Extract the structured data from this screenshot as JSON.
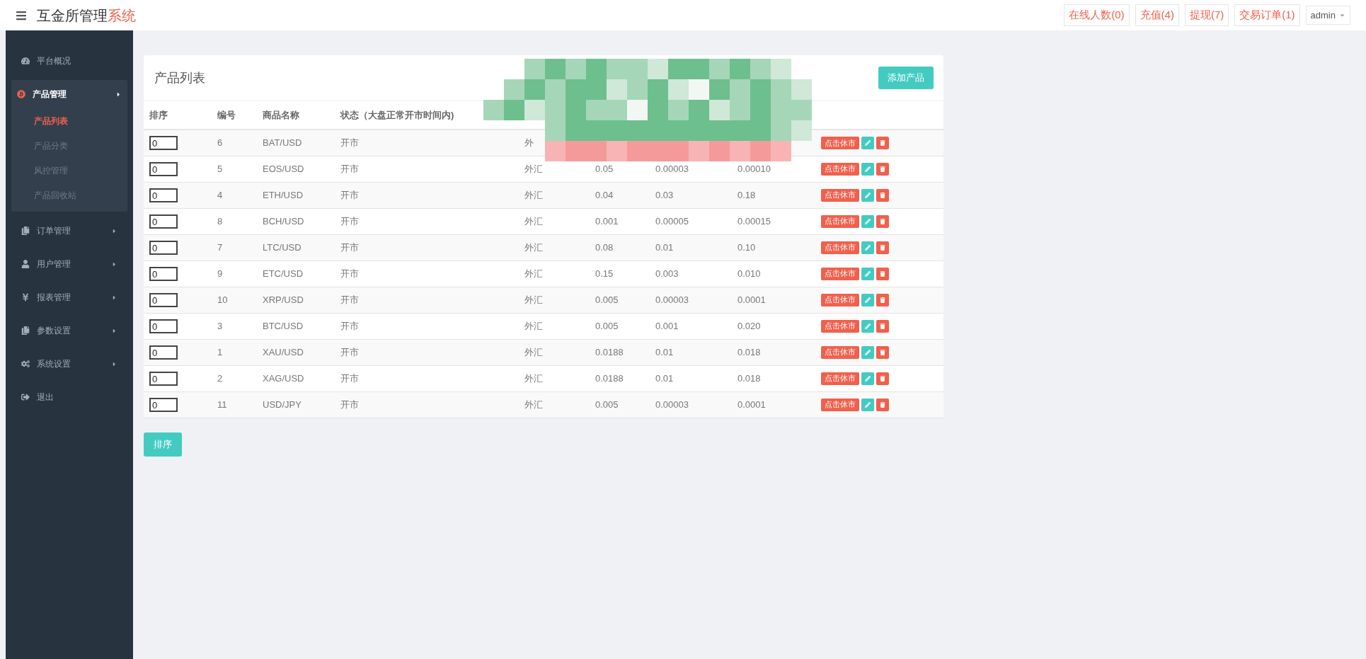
{
  "header": {
    "title": "互金所管理",
    "title_accent": "系统",
    "links": [
      "在线人数(0)",
      "充值(4)",
      "提现(7)",
      "交易订单(1)"
    ],
    "user": "admin"
  },
  "sidebar": {
    "items": [
      {
        "label": "平台概况",
        "expanded": false,
        "has_arrow": false
      },
      {
        "label": "产品管理",
        "expanded": true,
        "has_arrow": true,
        "children": [
          {
            "label": "产品列表",
            "selected": true
          },
          {
            "label": "产品分类",
            "selected": false
          },
          {
            "label": "风控管理",
            "selected": false
          },
          {
            "label": "产品回收站",
            "selected": false
          }
        ]
      },
      {
        "label": "订单管理",
        "expanded": false,
        "has_arrow": true
      },
      {
        "label": "用户管理",
        "expanded": false,
        "has_arrow": true
      },
      {
        "label": "报表管理",
        "expanded": false,
        "has_arrow": true
      },
      {
        "label": "参数设置",
        "expanded": false,
        "has_arrow": true
      },
      {
        "label": "系统设置",
        "expanded": false,
        "has_arrow": true
      },
      {
        "label": "退出",
        "expanded": false,
        "has_arrow": false
      }
    ]
  },
  "card": {
    "title": "产品列表",
    "add_button": "添加产品"
  },
  "table": {
    "columns": [
      "排序",
      "编号",
      "商品名称",
      "状态（大盘正常开市时间内)"
    ],
    "rows": [
      {
        "sort": "0",
        "id": "6",
        "name": "BAT/USD",
        "status": "开市",
        "type": "外",
        "action": "点击休市"
      },
      {
        "sort": "0",
        "id": "5",
        "name": "EOS/USD",
        "status": "开市",
        "type": "外汇",
        "value_1": "0.05",
        "value_2": "0.00003",
        "value_3": "0.00010",
        "action": "点击休市"
      },
      {
        "sort": "0",
        "id": "4",
        "name": "ETH/USD",
        "status": "开市",
        "type": "外汇",
        "value_1": "0.04",
        "value_2": "0.03",
        "value_3": "0.18",
        "action": "点击休市"
      },
      {
        "sort": "0",
        "id": "8",
        "name": "BCH/USD",
        "status": "开市",
        "type": "外汇",
        "value_1": "0.001",
        "value_2": "0.00005",
        "value_3": "0.00015",
        "action": "点击休市"
      },
      {
        "sort": "0",
        "id": "7",
        "name": "LTC/USD",
        "status": "开市",
        "type": "外汇",
        "value_1": "0.08",
        "value_2": "0.01",
        "value_3": "0.10",
        "action": "点击休市"
      },
      {
        "sort": "0",
        "id": "9",
        "name": "ETC/USD",
        "status": "开市",
        "type": "外汇",
        "value_1": "0.15",
        "value_2": "0.003",
        "value_3": "0.010",
        "action": "点击休市"
      },
      {
        "sort": "0",
        "id": "10",
        "name": "XRP/USD",
        "status": "开市",
        "type": "外汇",
        "value_1": "0.005",
        "value_2": "0.00003",
        "value_3": "0.0001",
        "action": "点击休市"
      },
      {
        "sort": "0",
        "id": "3",
        "name": "BTC/USD",
        "status": "开市",
        "type": "外汇",
        "value_1": "0.005",
        "value_2": "0.001",
        "value_3": "0.020",
        "action": "点击休市"
      },
      {
        "sort": "0",
        "id": "1",
        "name": "XAU/USD",
        "status": "开市",
        "type": "外汇",
        "value_1": "0.0188",
        "value_2": "0.01",
        "value_3": "0.018",
        "action": "点击休市"
      },
      {
        "sort": "0",
        "id": "2",
        "name": "XAG/USD",
        "status": "开市",
        "type": "外汇",
        "value_1": "0.0188",
        "value_2": "0.01",
        "value_3": "0.018",
        "action": "点击休市"
      },
      {
        "sort": "0",
        "id": "11",
        "name": "USD/JPY",
        "status": "开市",
        "type": "外汇",
        "value_1": "0.005",
        "value_2": "0.00003",
        "value_3": "0.0001",
        "action": "点击休市"
      }
    ]
  },
  "sort_button": "排序"
}
